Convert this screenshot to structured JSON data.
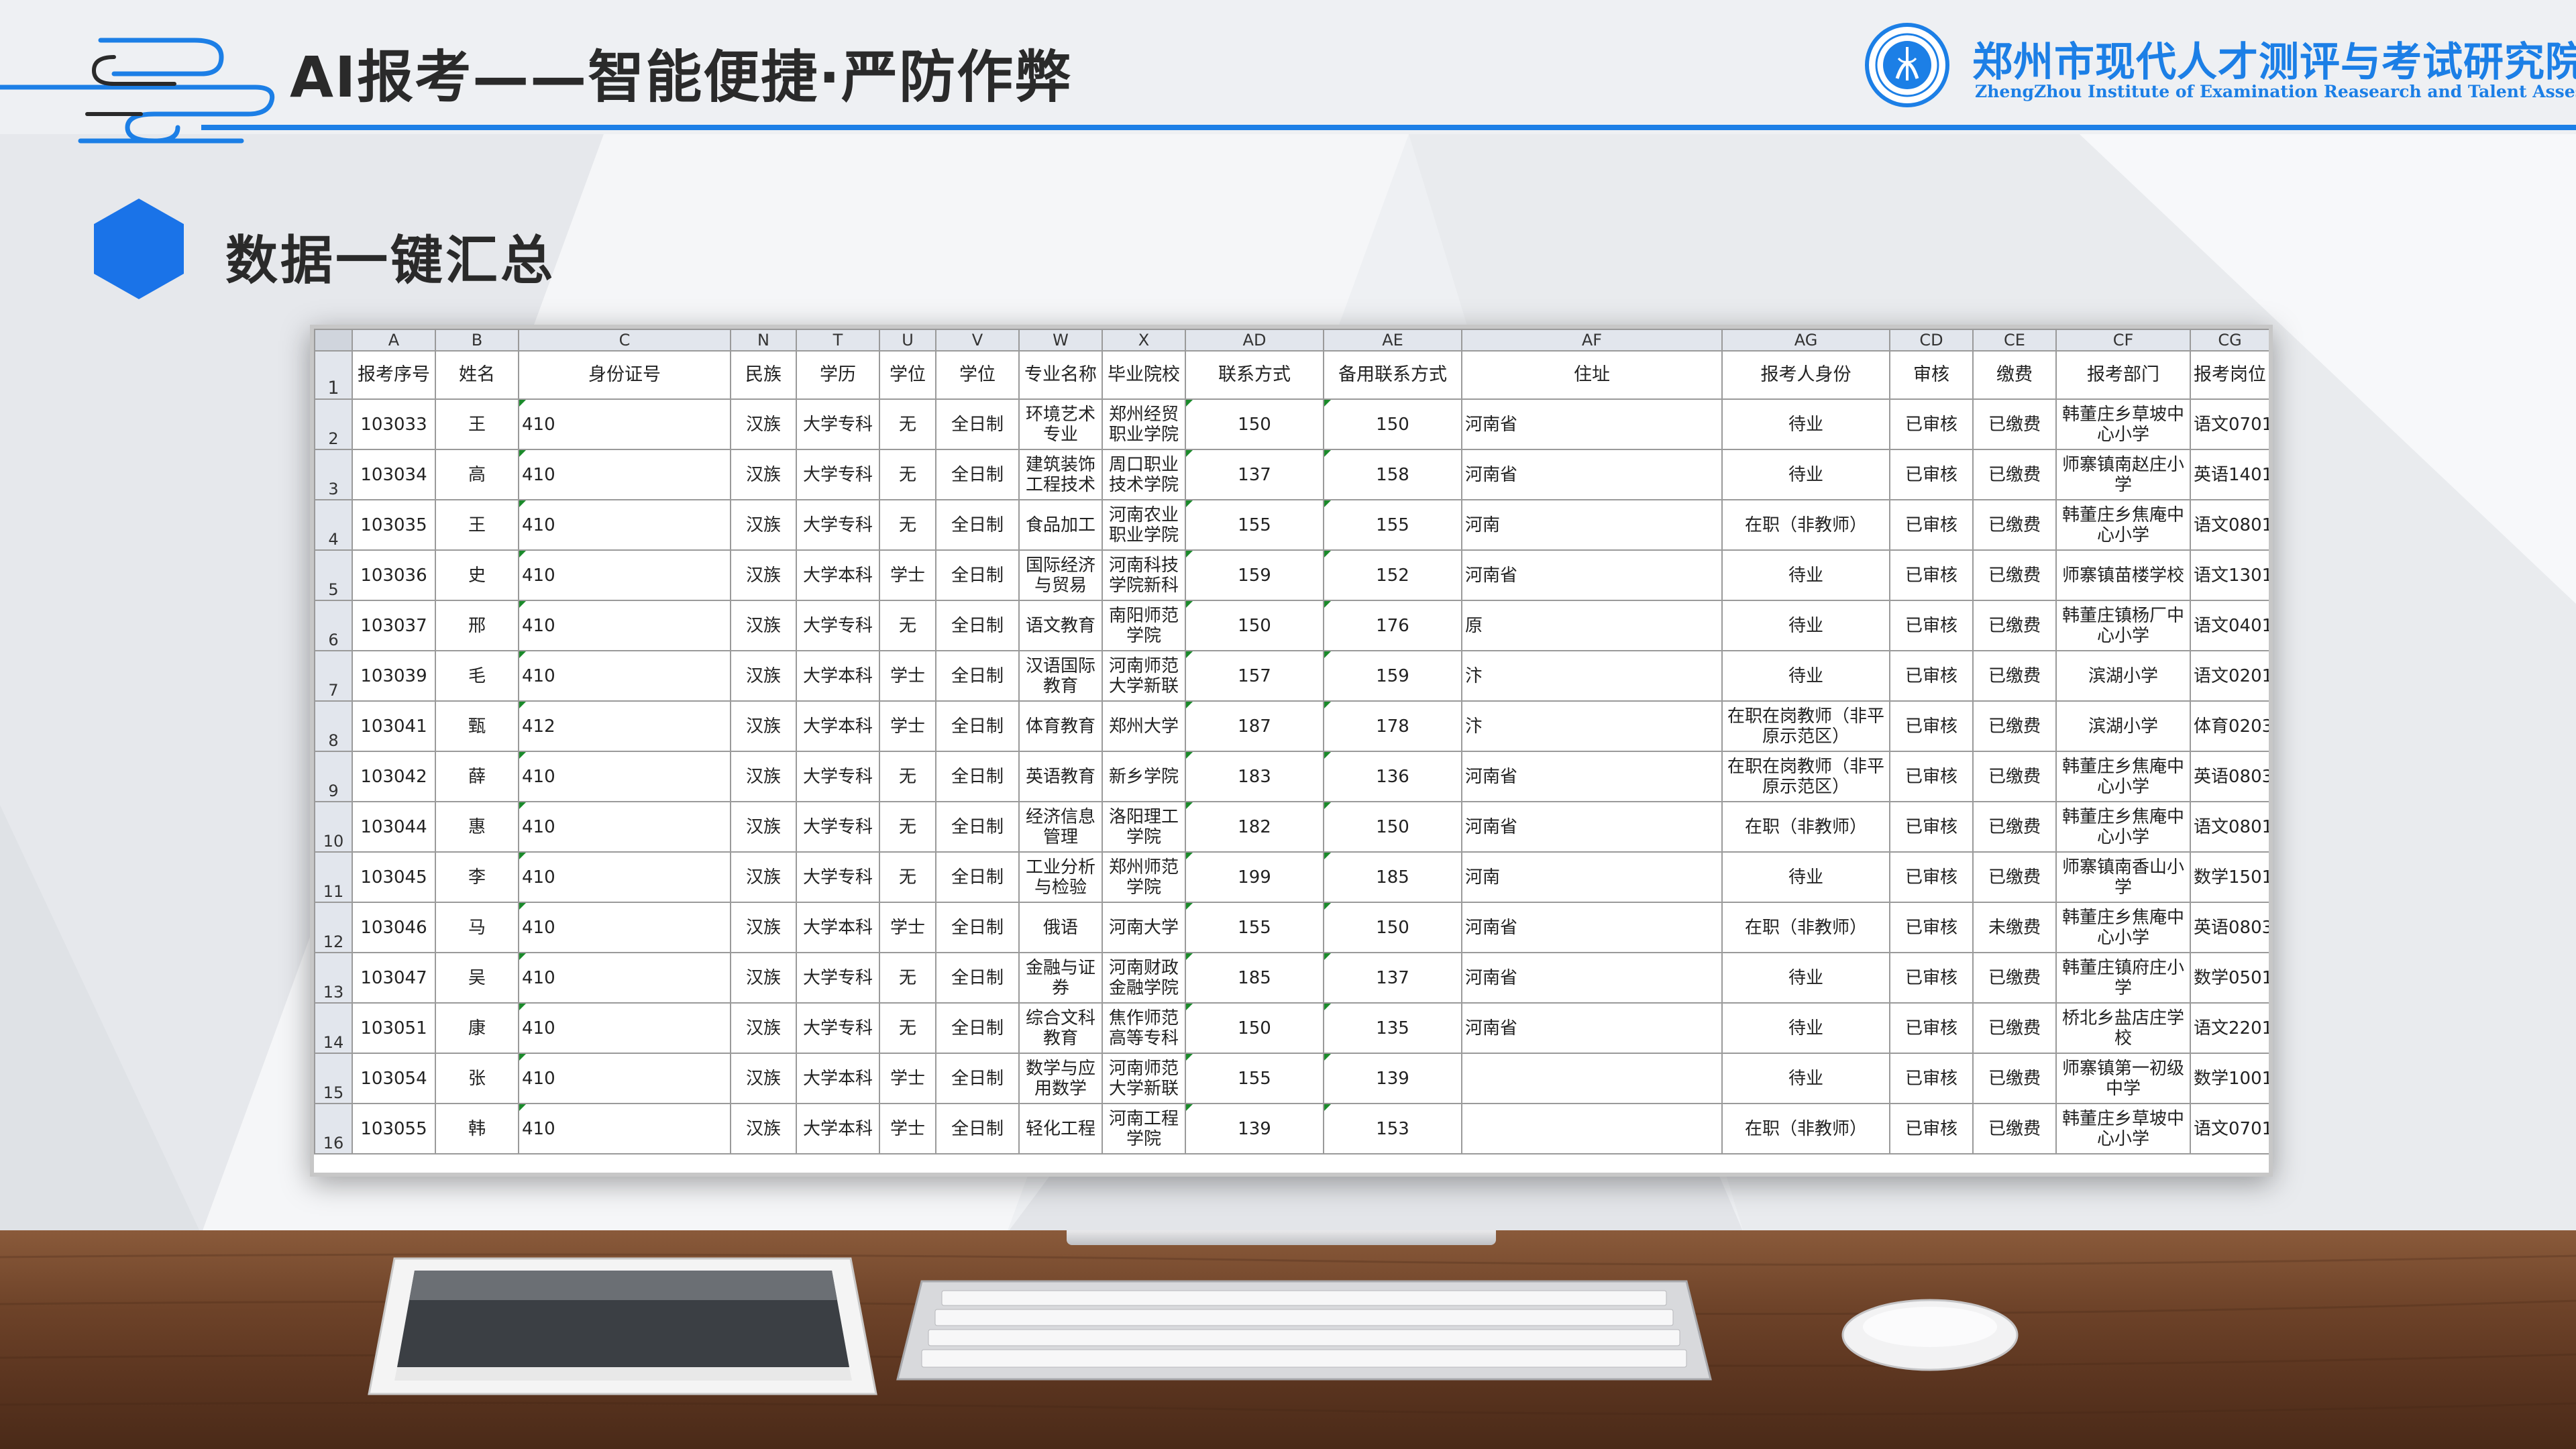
{
  "header": {
    "title": "AI报考——智能便捷·严防作弊",
    "org_cn": "郑州市现代人才测评与考试研究院",
    "org_en": "ZhengZhou Institute of Examination Reasearch and Talent Assessment"
  },
  "section": {
    "title": "数据一键汇总"
  },
  "colors": {
    "accent": "#1c7fe6",
    "hex": "#1a73e8"
  },
  "icons": [
    "cloud-swirl-icon",
    "institute-logo-icon",
    "hexagon-icon"
  ],
  "spreadsheet": {
    "columns": [
      "A",
      "B",
      "C",
      "N",
      "T",
      "U",
      "V",
      "W",
      "X",
      "AD",
      "AE",
      "AF",
      "AG",
      "CD",
      "CE",
      "CF",
      "CG"
    ],
    "headers": [
      "报考序号",
      "姓名",
      "身份证号",
      "民族",
      "学历",
      "学位",
      "学位",
      "专业名称",
      "毕业院校",
      "联系方式",
      "备用联系方式",
      "住址",
      "报考人身份",
      "审核",
      "缴费",
      "报考部门",
      "报考岗位"
    ],
    "header_row_number": "1",
    "rows": [
      {
        "n": "2",
        "cells": [
          "103033",
          "王",
          "410",
          "汉族",
          "大学专科",
          "无",
          "全日制",
          "环境艺术专业",
          "郑州经贸职业学院",
          "150",
          "150",
          "河南省",
          "待业",
          "已审核",
          "已缴费",
          "韩董庄乡草坡中心小学",
          "语文0701"
        ]
      },
      {
        "n": "3",
        "cells": [
          "103034",
          "高",
          "410",
          "汉族",
          "大学专科",
          "无",
          "全日制",
          "建筑装饰工程技术",
          "周口职业技术学院",
          "137",
          "158",
          "河南省",
          "待业",
          "已审核",
          "已缴费",
          "师寨镇南赵庄小学",
          "英语1401"
        ]
      },
      {
        "n": "4",
        "cells": [
          "103035",
          "王",
          "410",
          "汉族",
          "大学专科",
          "无",
          "全日制",
          "食品加工",
          "河南农业职业学院",
          "155",
          "155",
          "河南",
          "在职（非教师）",
          "已审核",
          "已缴费",
          "韩董庄乡焦庵中心小学",
          "语文0801"
        ]
      },
      {
        "n": "5",
        "cells": [
          "103036",
          "史",
          "410",
          "汉族",
          "大学本科",
          "学士",
          "全日制",
          "国际经济与贸易",
          "河南科技学院新科",
          "159",
          "152",
          "河南省",
          "待业",
          "已审核",
          "已缴费",
          "师寨镇苗楼学校",
          "语文1301"
        ]
      },
      {
        "n": "6",
        "cells": [
          "103037",
          "邢",
          "410",
          "汉族",
          "大学专科",
          "无",
          "全日制",
          "语文教育",
          "南阳师范学院",
          "150",
          "176",
          "原",
          "待业",
          "已审核",
          "已缴费",
          "韩董庄镇杨厂中心小学",
          "语文0401"
        ]
      },
      {
        "n": "7",
        "cells": [
          "103039",
          "毛",
          "410",
          "汉族",
          "大学本科",
          "学士",
          "全日制",
          "汉语国际教育",
          "河南师范大学新联",
          "157",
          "159",
          "汴",
          "待业",
          "已审核",
          "已缴费",
          "滨湖小学",
          "语文0201"
        ]
      },
      {
        "n": "8",
        "cells": [
          "103041",
          "甄",
          "412",
          "汉族",
          "大学本科",
          "学士",
          "全日制",
          "体育教育",
          "郑州大学",
          "187",
          "178",
          "汴",
          "在职在岗教师（非平原示范区）",
          "已审核",
          "已缴费",
          "滨湖小学",
          "体育0203"
        ]
      },
      {
        "n": "9",
        "cells": [
          "103042",
          "薛",
          "410",
          "汉族",
          "大学专科",
          "无",
          "全日制",
          "英语教育",
          "新乡学院",
          "183",
          "136",
          "河南省",
          "在职在岗教师（非平原示范区）",
          "已审核",
          "已缴费",
          "韩董庄乡焦庵中心小学",
          "英语0803"
        ]
      },
      {
        "n": "10",
        "cells": [
          "103044",
          "惠",
          "410",
          "汉族",
          "大学专科",
          "无",
          "全日制",
          "经济信息管理",
          "洛阳理工学院",
          "182",
          "150",
          "河南省",
          "在职（非教师）",
          "已审核",
          "已缴费",
          "韩董庄乡焦庵中心小学",
          "语文0801"
        ]
      },
      {
        "n": "11",
        "cells": [
          "103045",
          "李",
          "410",
          "汉族",
          "大学专科",
          "无",
          "全日制",
          "工业分析与检验",
          "郑州师范学院",
          "199",
          "185",
          "河南",
          "待业",
          "已审核",
          "已缴费",
          "师寨镇南香山小学",
          "数学1501"
        ]
      },
      {
        "n": "12",
        "cells": [
          "103046",
          "马",
          "410",
          "汉族",
          "大学本科",
          "学士",
          "全日制",
          "俄语",
          "河南大学",
          "155",
          "150",
          "河南省",
          "在职（非教师）",
          "已审核",
          "未缴费",
          "韩董庄乡焦庵中心小学",
          "英语0803"
        ]
      },
      {
        "n": "13",
        "cells": [
          "103047",
          "吴",
          "410",
          "汉族",
          "大学专科",
          "无",
          "全日制",
          "金融与证券",
          "河南财政金融学院",
          "185",
          "137",
          "河南省",
          "待业",
          "已审核",
          "已缴费",
          "韩董庄镇府庄小学",
          "数学0501"
        ]
      },
      {
        "n": "14",
        "cells": [
          "103051",
          "康",
          "410",
          "汉族",
          "大学专科",
          "无",
          "全日制",
          "综合文科教育",
          "焦作师范高等专科",
          "150",
          "135",
          "河南省",
          "待业",
          "已审核",
          "已缴费",
          "桥北乡盐店庄学校",
          "语文2201"
        ]
      },
      {
        "n": "15",
        "cells": [
          "103054",
          "张",
          "410",
          "汉族",
          "大学本科",
          "学士",
          "全日制",
          "数学与应用数学",
          "河南师范大学新联",
          "155",
          "139",
          "",
          "待业",
          "已审核",
          "已缴费",
          "师寨镇第一初级中学",
          "数学1001"
        ]
      },
      {
        "n": "16",
        "cells": [
          "103055",
          "韩",
          "410",
          "汉族",
          "大学本科",
          "学士",
          "全日制",
          "轻化工程",
          "河南工程学院",
          "139",
          "153",
          "",
          "在职（非教师）",
          "已审核",
          "已缴费",
          "韩董庄乡草坡中心小学",
          "语文0701"
        ]
      }
    ]
  }
}
